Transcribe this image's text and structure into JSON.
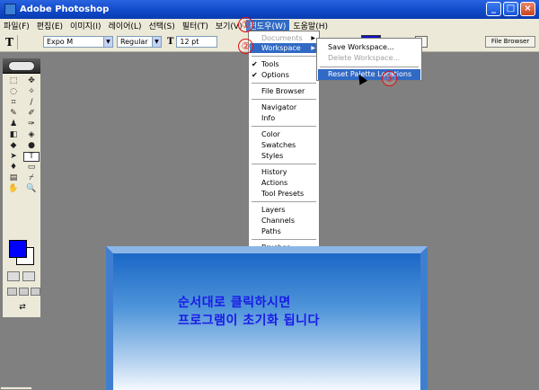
{
  "window": {
    "title": "Adobe Photoshop",
    "controls": [
      "_",
      "□",
      "×"
    ]
  },
  "menubar": {
    "items": [
      "파일(F)",
      "편집(E)",
      "이미지(I)",
      "레이어(L)",
      "선택(S)",
      "필터(T)",
      "보기(V)",
      "윈도우(W)",
      "도움말(H)"
    ],
    "active_index": 7
  },
  "options": {
    "tool_glyph": "T",
    "font_family": "Expo M",
    "font_style": "Regular",
    "font_size": "12 pt",
    "color_swatch": "#1010c8",
    "file_browser_tab": "File Browser"
  },
  "toolbox": {
    "tools": [
      "⬚",
      "✥",
      "◌",
      "✧",
      "⌗",
      "∕",
      "✎",
      "✐",
      "♟",
      "✑",
      "◧",
      "◈",
      "◆",
      "●",
      "➤",
      "T",
      "♦",
      "▭",
      "▤",
      "⌿",
      "✋",
      "🔍"
    ],
    "selected_index": 15,
    "foreground_color": "#0000ff",
    "background_color": "#ffffff",
    "jump_glyph": "⇄"
  },
  "window_menu": {
    "items": [
      {
        "label": "Documents",
        "disabled": true,
        "submenu": true
      },
      {
        "label": "Workspace",
        "highlighted": true,
        "submenu": true
      },
      {
        "label": "Tools",
        "checked": true
      },
      {
        "label": "Options",
        "checked": true
      },
      {
        "label": "File Browser"
      },
      {
        "label": "Navigator"
      },
      {
        "label": "Info"
      },
      {
        "label": "Color"
      },
      {
        "label": "Swatches"
      },
      {
        "label": "Styles"
      },
      {
        "label": "History"
      },
      {
        "label": "Actions"
      },
      {
        "label": "Tool Presets"
      },
      {
        "label": "Layers"
      },
      {
        "label": "Channels"
      },
      {
        "label": "Paths"
      },
      {
        "label": "Brushes"
      }
    ]
  },
  "workspace_submenu": {
    "items": [
      {
        "label": "Save Workspace..."
      },
      {
        "label": "Delete Workspace...",
        "disabled": true
      },
      {
        "label": "Reset Palette Locations",
        "highlighted": true
      }
    ]
  },
  "step_badges": [
    "①",
    "②",
    "③"
  ],
  "callout": {
    "line1": "순서대로 클릭하시면",
    "line2": "프로그램이 초기화 됩니다"
  },
  "colors": {
    "titlebar": "#0f48c8",
    "highlight": "#316ac5",
    "badge": "#e01010",
    "callout_text": "#1a1ae6"
  }
}
